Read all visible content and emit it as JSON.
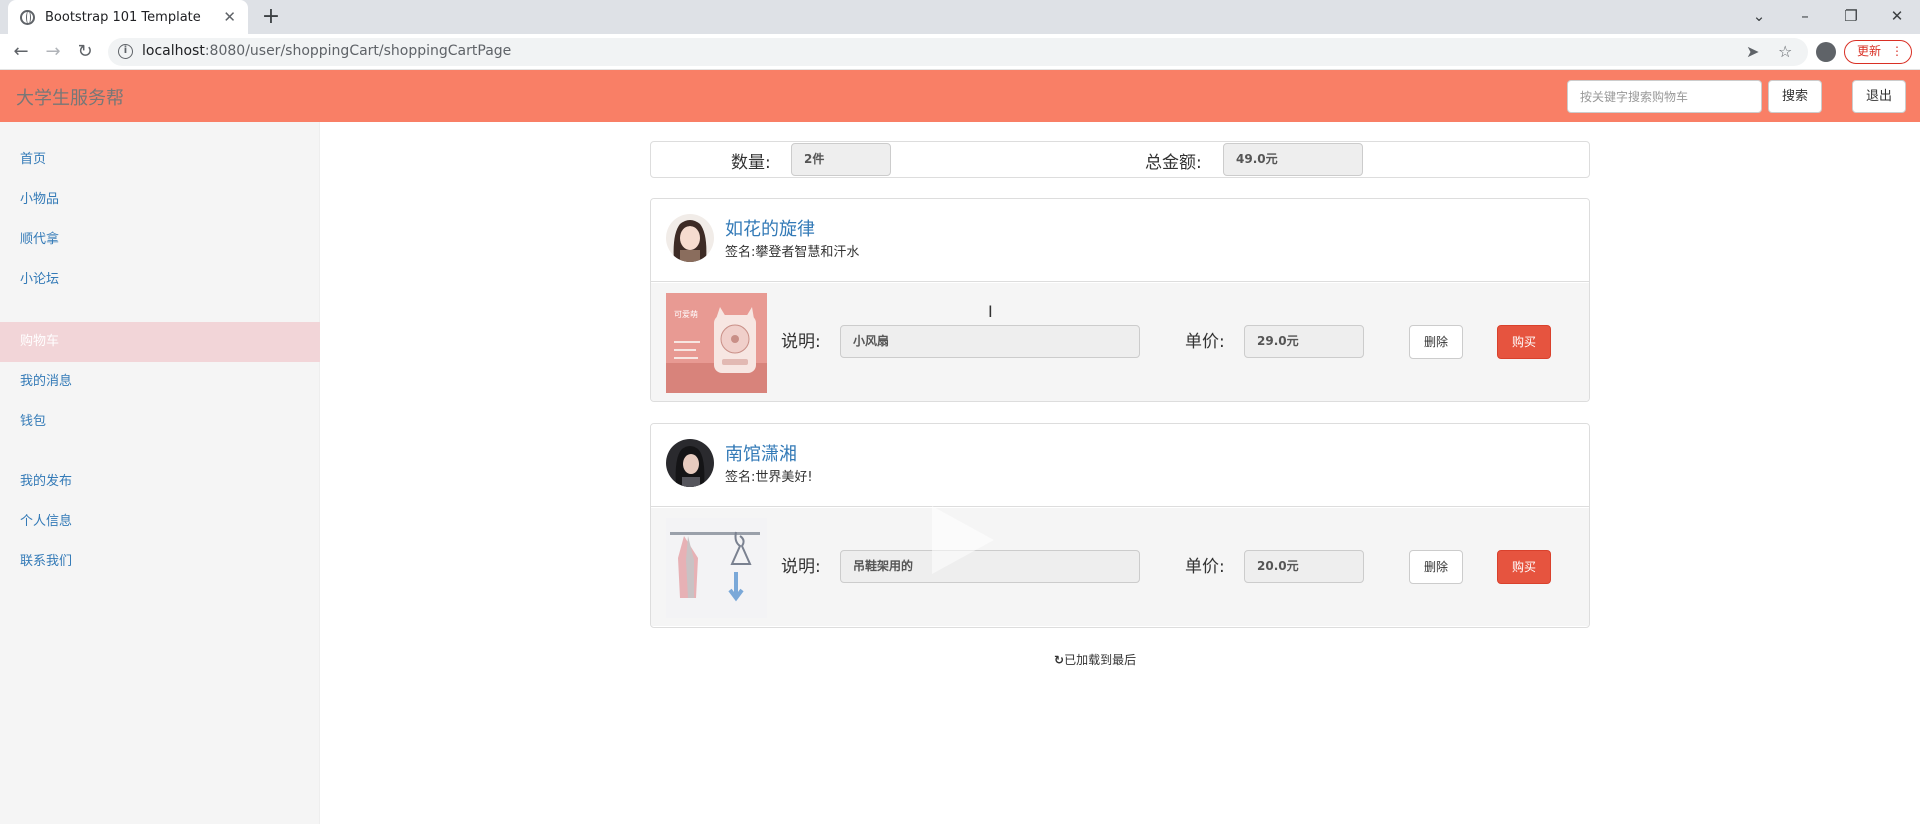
{
  "browser": {
    "tab_title": "Bootstrap 101 Template",
    "tab_close": "✕",
    "new_tab": "+",
    "url_host": "localhost",
    "url_path": ":8080/user/shoppingCart/shoppingCartPage",
    "update_label": "更新",
    "icons": [
      "globe-icon",
      "close-icon",
      "plus-icon",
      "chevron-down-icon",
      "minimize-icon",
      "restore-icon",
      "close-window-icon",
      "back-icon",
      "forward-icon",
      "reload-icon",
      "info-icon",
      "send-icon",
      "star-icon",
      "profile-icon",
      "kebab-icon"
    ]
  },
  "header": {
    "brand": "大学生服务帮",
    "search_placeholder": "按关键字搜索购物车",
    "search_label": "搜索",
    "logout_label": "退出",
    "color": "#f97f66"
  },
  "sidebar": {
    "items": [
      {
        "label": "首页"
      },
      {
        "label": "小物品"
      },
      {
        "label": "顺代拿"
      },
      {
        "label": "小论坛"
      },
      {
        "label": "购物车",
        "active": true
      },
      {
        "label": "我的消息"
      },
      {
        "label": "钱包"
      },
      {
        "label": "我的发布"
      },
      {
        "label": "个人信息"
      },
      {
        "label": "联系我们"
      }
    ]
  },
  "summary": {
    "count_label": "数量:",
    "count_value": "2件",
    "total_label": "总金额:",
    "total_value": "49.0元"
  },
  "cart": [
    {
      "seller_name": "如花的旋律",
      "sign_label": "签名:",
      "sign_text": "攀登者智慧和汗水",
      "desc_label": "说明:",
      "desc_value": "小风扇",
      "price_label": "单价:",
      "price_value": "29.0元",
      "delete_label": "删除",
      "buy_label": "购买",
      "product_image_text": "可爱萌"
    },
    {
      "seller_name": "南馆潇湘",
      "sign_label": "签名:",
      "sign_text": "世界美好!",
      "desc_label": "说明:",
      "desc_value": "吊鞋架用的",
      "price_label": "单价:",
      "price_value": "20.0元",
      "delete_label": "删除",
      "buy_label": "购买"
    }
  ],
  "footer": {
    "loaded_text": "已加载到最后"
  }
}
